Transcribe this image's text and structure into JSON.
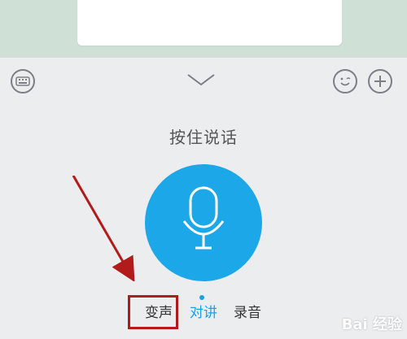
{
  "panel": {
    "hint": "按住说话",
    "tabs": [
      {
        "label": "变声"
      },
      {
        "label": "对讲"
      },
      {
        "label": "录音"
      }
    ],
    "active_tab": "对讲"
  },
  "icons": {
    "keyboard": "keyboard-icon",
    "collapse": "chevron-down-icon",
    "emoji": "emoji-icon",
    "plus": "plus-icon",
    "mic": "microphone-icon"
  },
  "colors": {
    "accent": "#1aa0e6",
    "highlight": "#b21b1b"
  },
  "watermark": "Bai 经验"
}
